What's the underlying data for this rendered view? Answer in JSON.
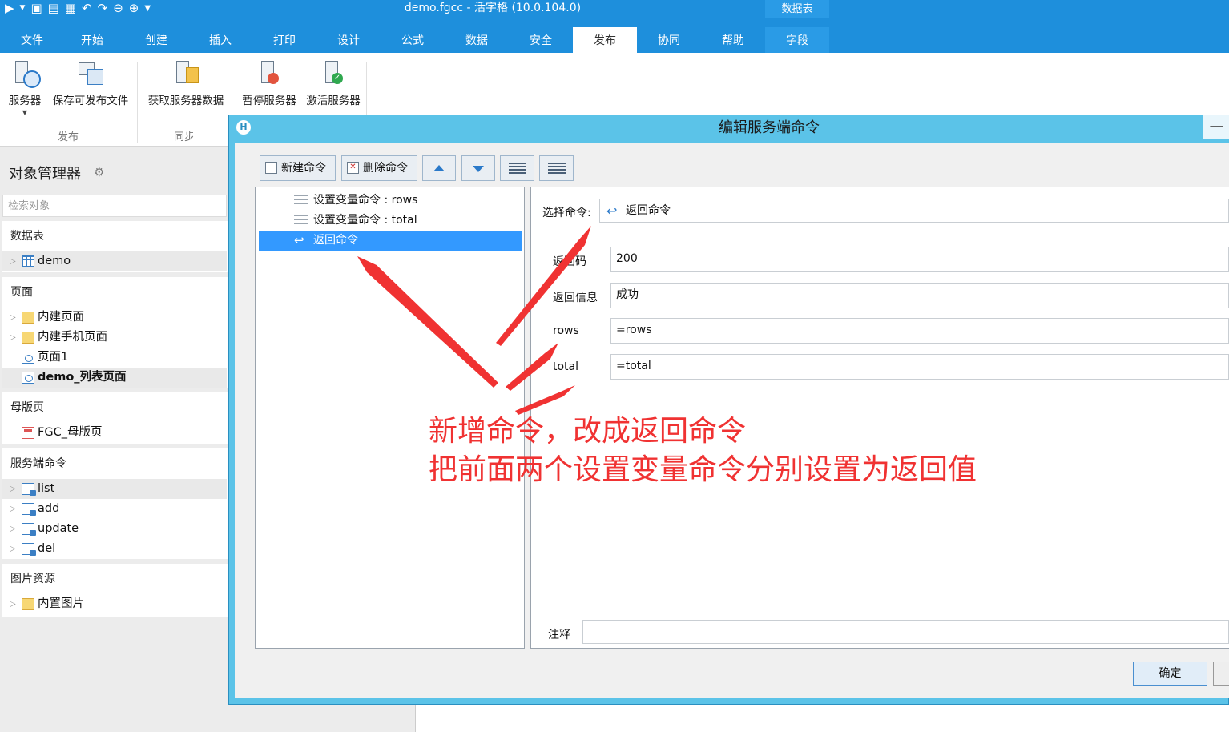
{
  "app": {
    "title": "demo.fgcc - 活字格 (10.0.104.0)",
    "context_tab_group": "数据表"
  },
  "ribbon": {
    "tabs": [
      "文件",
      "开始",
      "创建",
      "插入",
      "打印",
      "设计",
      "公式",
      "数据",
      "安全",
      "发布",
      "协同",
      "帮助",
      "字段"
    ],
    "active_tab": "发布",
    "buttons": {
      "server": "服务器",
      "save_publishable": "保存可发布文件",
      "fetch_server_data": "获取服务器数据",
      "pause_server": "暂停服务器",
      "activate_server": "激活服务器"
    },
    "groups": {
      "publish": "发布",
      "sync": "同步"
    }
  },
  "object_manager": {
    "title": "对象管理器",
    "search_placeholder": "检索对象",
    "sections": {
      "tables": {
        "label": "数据表",
        "items": [
          "demo"
        ]
      },
      "pages": {
        "label": "页面",
        "items": [
          "内建页面",
          "内建手机页面",
          "页面1",
          "demo_列表页面"
        ]
      },
      "master_pages": {
        "label": "母版页",
        "items": [
          "FGC_母版页"
        ]
      },
      "server_commands": {
        "label": "服务端命令",
        "items": [
          "list",
          "add",
          "update",
          "del"
        ]
      },
      "images": {
        "label": "图片资源",
        "items": [
          "内置图片"
        ]
      }
    }
  },
  "dialog": {
    "title": "编辑服务端命令",
    "logo_letter": "H",
    "toolbar": {
      "new_command": "新建命令",
      "delete_command": "删除命令"
    },
    "commands": [
      "设置变量命令 : rows",
      "设置变量命令 : total",
      "返回命令"
    ],
    "select_command_label": "选择命令:",
    "select_command_value": "返回命令",
    "fields": [
      {
        "label": "返回码",
        "value": "200"
      },
      {
        "label": "返回信息",
        "value": "成功"
      },
      {
        "label": "rows",
        "value": "=rows"
      },
      {
        "label": "total",
        "value": "=total"
      }
    ],
    "comment_label": "注释",
    "comment_value": "",
    "ok_button": "确定"
  },
  "annotation": {
    "line1": "新增命令，改成返回命令",
    "line2": "把前面两个设置变量命令分别设置为返回值",
    "color": "#f03232"
  }
}
